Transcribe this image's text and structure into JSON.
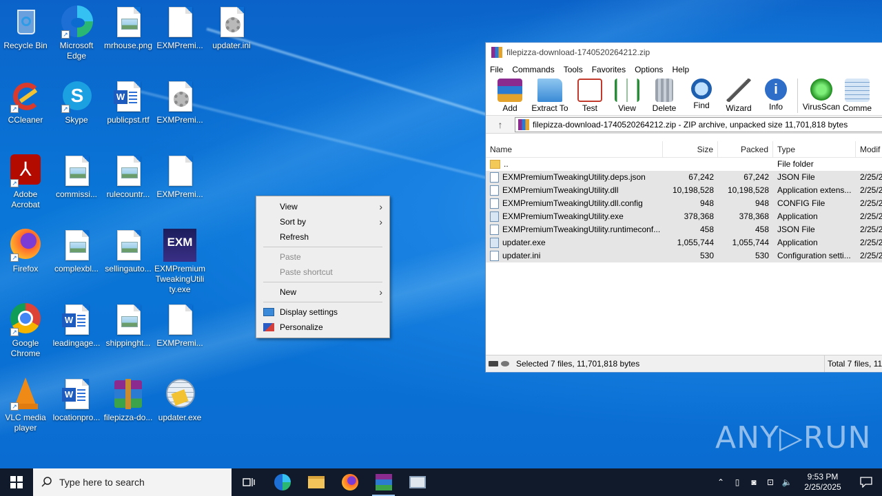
{
  "desktop_icons": [
    {
      "label": "Recycle Bin"
    },
    {
      "label": "Microsoft Edge"
    },
    {
      "label": "mrhouse.png"
    },
    {
      "label": "EXMPremi..."
    },
    {
      "label": "updater.ini"
    },
    {
      "label": "CCleaner"
    },
    {
      "label": "Skype"
    },
    {
      "label": "publicpst.rtf"
    },
    {
      "label": "EXMPremi..."
    },
    {
      "label": "Adobe Acrobat"
    },
    {
      "label": "commissi..."
    },
    {
      "label": "rulecountr..."
    },
    {
      "label": "EXMPremi..."
    },
    {
      "label": "Firefox"
    },
    {
      "label": "complexbl..."
    },
    {
      "label": "sellingauto..."
    },
    {
      "label": "EXMPremiumTweakingUtility.exe"
    },
    {
      "label": "Google Chrome"
    },
    {
      "label": "leadingage..."
    },
    {
      "label": "shippinght..."
    },
    {
      "label": "EXMPremi..."
    },
    {
      "label": "VLC media player"
    },
    {
      "label": "locationpro..."
    },
    {
      "label": "filepizza-do..."
    },
    {
      "label": "updater.exe"
    }
  ],
  "context_menu": {
    "view": "View",
    "sort_by": "Sort by",
    "refresh": "Refresh",
    "paste": "Paste",
    "paste_shortcut": "Paste shortcut",
    "new": "New",
    "display_settings": "Display settings",
    "personalize": "Personalize"
  },
  "winrar": {
    "title": "filepizza-download-1740520264212.zip",
    "menu": [
      "File",
      "Commands",
      "Tools",
      "Favorites",
      "Options",
      "Help"
    ],
    "toolbar": [
      "Add",
      "Extract To",
      "Test",
      "View",
      "Delete",
      "Find",
      "Wizard",
      "Info",
      "VirusScan",
      "Comme"
    ],
    "path": "filepizza-download-1740520264212.zip - ZIP archive, unpacked size 11,701,818 bytes",
    "columns": {
      "name": "Name",
      "size": "Size",
      "packed": "Packed",
      "type": "Type",
      "modified": "Modif"
    },
    "rows": [
      {
        "name": "..",
        "size": "",
        "packed": "",
        "type": "File folder",
        "modified": ""
      },
      {
        "name": "EXMPremiumTweakingUtility.deps.json",
        "size": "67,242",
        "packed": "67,242",
        "type": "JSON File",
        "modified": "2/25/2"
      },
      {
        "name": "EXMPremiumTweakingUtility.dll",
        "size": "10,198,528",
        "packed": "10,198,528",
        "type": "Application extens...",
        "modified": "2/25/2"
      },
      {
        "name": "EXMPremiumTweakingUtility.dll.config",
        "size": "948",
        "packed": "948",
        "type": "CONFIG File",
        "modified": "2/25/2"
      },
      {
        "name": "EXMPremiumTweakingUtility.exe",
        "size": "378,368",
        "packed": "378,368",
        "type": "Application",
        "modified": "2/25/2"
      },
      {
        "name": "EXMPremiumTweakingUtility.runtimeconf...",
        "size": "458",
        "packed": "458",
        "type": "JSON File",
        "modified": "2/25/2"
      },
      {
        "name": "updater.exe",
        "size": "1,055,744",
        "packed": "1,055,744",
        "type": "Application",
        "modified": "2/25/2"
      },
      {
        "name": "updater.ini",
        "size": "530",
        "packed": "530",
        "type": "Configuration setti...",
        "modified": "2/25/2"
      }
    ],
    "status_left": "Selected 7 files, 11,701,818 bytes",
    "status_right": "Total 7 files, 11,"
  },
  "watermark": "ANY▷RUN",
  "taskbar": {
    "search_placeholder": "Type here to search",
    "time": "9:53 PM",
    "date": "2/25/2025"
  }
}
